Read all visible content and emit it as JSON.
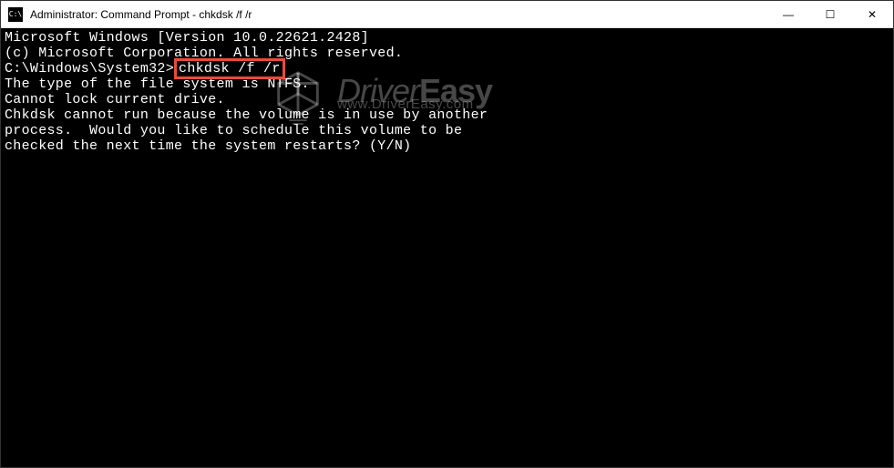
{
  "titlebar": {
    "icon_label": "C:\\",
    "title": "Administrator: Command Prompt - chkdsk  /f /r"
  },
  "window_controls": {
    "minimize": "—",
    "maximize": "☐",
    "close": "✕"
  },
  "terminal": {
    "line1": "Microsoft Windows [Version 10.0.22621.2428]",
    "line2": "(c) Microsoft Corporation. All rights reserved.",
    "blank1": "",
    "prompt_prefix": "C:\\Windows\\System32>",
    "command": "chkdsk /f /r",
    "line4": "The type of the file system is NTFS.",
    "line5": "Cannot lock current drive.",
    "blank2": "",
    "line6": "Chkdsk cannot run because the volume is in use by another",
    "line7": "process.  Would you like to schedule this volume to be",
    "line8": "checked the next time the system restarts? (Y/N)"
  },
  "watermark": {
    "title_part1": "Driver",
    "title_part2": "Easy",
    "url": "www.DriverEasy.com"
  }
}
